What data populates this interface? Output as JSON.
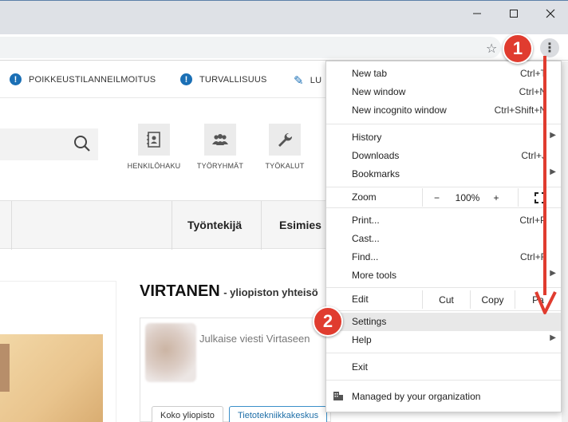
{
  "chrome": {
    "window_controls": [
      "minimize-icon",
      "maximize-icon",
      "close-icon"
    ],
    "bookmark_star_icon": "star-icon",
    "menu_icon": "kebab-icon"
  },
  "page": {
    "topnav": [
      {
        "label": "POIKKEUSTILANNEILMOITUS",
        "icon": "info-icon"
      },
      {
        "label": "TURVALLISUUS",
        "icon": "info-icon"
      },
      {
        "label": "LU",
        "icon": "pencil-icon"
      }
    ],
    "tools": [
      {
        "label": "HENKILÖHAKU",
        "icon": "contact-book-icon"
      },
      {
        "label": "TYÖRYHMÄT",
        "icon": "group-icon"
      },
      {
        "label": "TYÖKALUT",
        "icon": "wrench-icon"
      }
    ],
    "tabs": [
      "Työntekijä",
      "Esimies"
    ],
    "heading_name": "VIRTANEN",
    "heading_sub": "- yliopiston yhteisö",
    "post_placeholder": "Julkaise viesti Virtaseen",
    "chips": [
      "Koko yliopisto",
      "Tietotekniikkakeskus"
    ]
  },
  "menu": {
    "items": {
      "new_tab": {
        "label": "New tab",
        "shortcut": "Ctrl+T"
      },
      "new_window": {
        "label": "New window",
        "shortcut": "Ctrl+N"
      },
      "new_incognito": {
        "label": "New incognito window",
        "shortcut": "Ctrl+Shift+N"
      },
      "history": {
        "label": "History"
      },
      "downloads": {
        "label": "Downloads",
        "shortcut": "Ctrl+J"
      },
      "bookmarks": {
        "label": "Bookmarks"
      },
      "print": {
        "label": "Print...",
        "shortcut": "Ctrl+P"
      },
      "cast": {
        "label": "Cast..."
      },
      "find": {
        "label": "Find...",
        "shortcut": "Ctrl+F"
      },
      "more_tools": {
        "label": "More tools"
      },
      "settings": {
        "label": "Settings"
      },
      "help": {
        "label": "Help"
      },
      "exit": {
        "label": "Exit"
      },
      "managed": {
        "label": "Managed by your organization"
      }
    },
    "zoom": {
      "label": "Zoom",
      "minus": "−",
      "value": "100%",
      "plus": "+"
    },
    "edit": {
      "label": "Edit",
      "cut": "Cut",
      "copy": "Copy",
      "paste": "Pa"
    }
  },
  "annotations": {
    "step1": "1",
    "step2": "2",
    "color": "#e03c2f"
  }
}
